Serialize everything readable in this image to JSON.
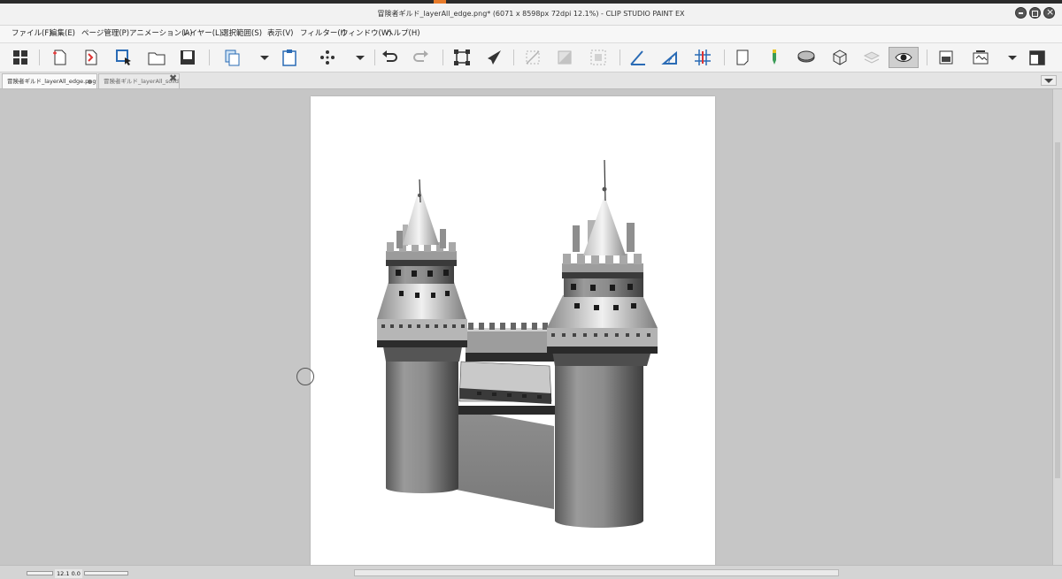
{
  "window": {
    "title": "冒険者ギルド_layerAll_edge.png* (6071 x 8598px 72dpi 12.1%)  - CLIP STUDIO PAINT EX"
  },
  "menu": {
    "items": [
      {
        "label": "ファイル(F)"
      },
      {
        "label": "編集(E)"
      },
      {
        "label": "ページ管理(P)"
      },
      {
        "label": "アニメーション(A)"
      },
      {
        "label": "レイヤー(L)"
      },
      {
        "label": "選択範囲(S)"
      },
      {
        "label": "表示(V)"
      },
      {
        "label": "フィルター(I)"
      },
      {
        "label": "ウィンドウ(W)"
      },
      {
        "label": "ヘルプ(H)"
      }
    ]
  },
  "toolbar": {
    "buttons": [
      {
        "icon": "grid-icon"
      },
      {
        "icon": "new-document-icon"
      },
      {
        "icon": "new-page-icon"
      },
      {
        "icon": "select-layer-icon"
      },
      {
        "icon": "open-folder-icon"
      },
      {
        "icon": "save-icon"
      },
      {
        "icon": "copy-icon"
      },
      {
        "icon": "paste-icon"
      },
      {
        "icon": "dots-icon"
      },
      {
        "icon": "undo-icon"
      },
      {
        "icon": "redo-icon"
      },
      {
        "icon": "transform-icon"
      },
      {
        "icon": "pen-nib-icon"
      },
      {
        "icon": "clear-selection-icon"
      },
      {
        "icon": "fill-icon"
      },
      {
        "icon": "marquee-icon"
      },
      {
        "icon": "ruler-icon"
      },
      {
        "icon": "ruler-snap-icon"
      },
      {
        "icon": "grid-snap-icon"
      },
      {
        "icon": "page-icon"
      },
      {
        "icon": "color-pen-icon"
      },
      {
        "icon": "disk-icon"
      },
      {
        "icon": "3d-object-icon"
      },
      {
        "icon": "layers-icon"
      },
      {
        "icon": "eye-icon"
      },
      {
        "icon": "image-icon"
      },
      {
        "icon": "frame-icon"
      },
      {
        "icon": "window-icon"
      }
    ]
  },
  "tabs": [
    {
      "label": "冒険者ギルド_layerAll_edge.png*",
      "active": true
    },
    {
      "label": "冒険者ギルド_layerAll_solid",
      "active": false
    }
  ],
  "canvas": {
    "image": "castle-with-two-towers"
  },
  "status": {
    "zoom": "12.1",
    "angle": "0.0"
  },
  "colors": {
    "page": "#ffffff",
    "workspace": "#c6c6c6",
    "toolbar": "#f4f4f4"
  }
}
